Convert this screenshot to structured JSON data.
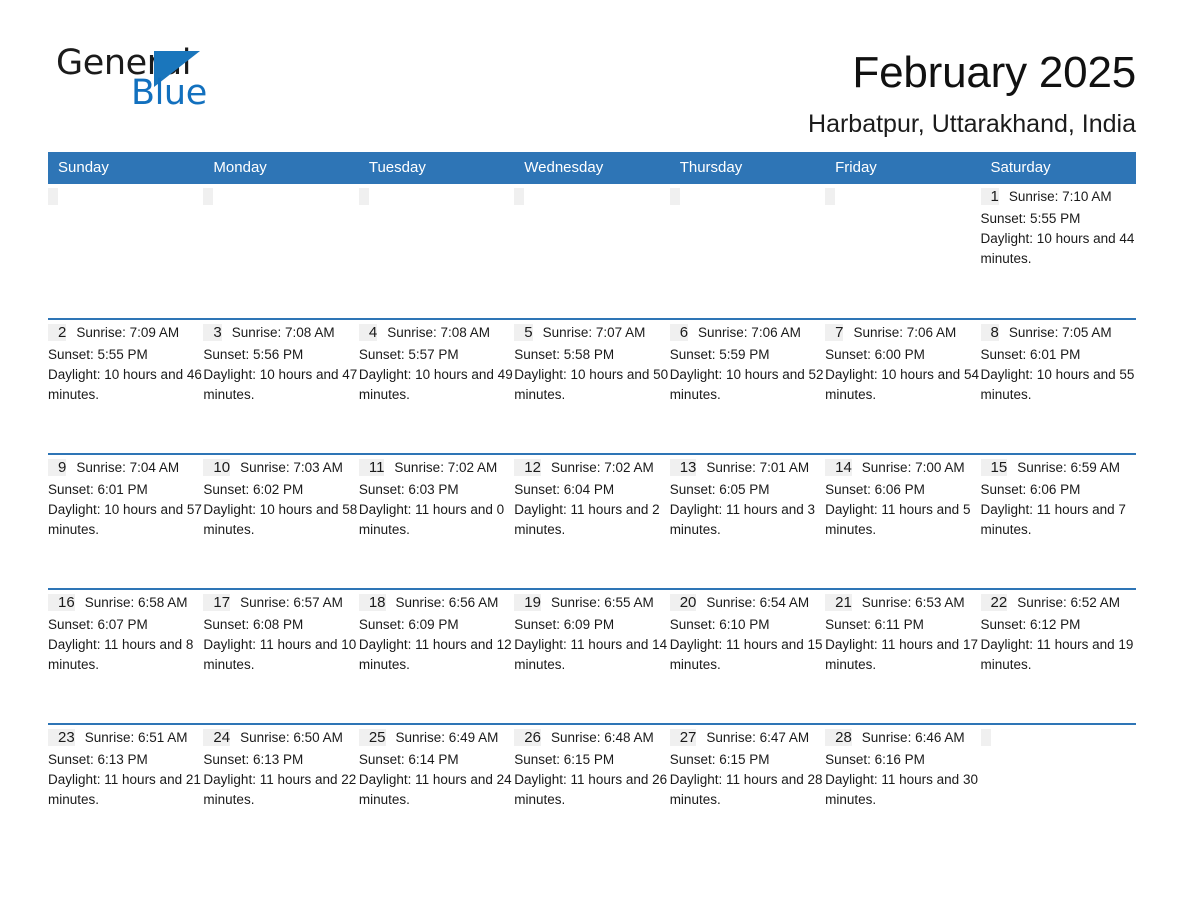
{
  "brand": {
    "name_part1": "General",
    "name_part2": "Blue",
    "triangle_color": "#1a76bc",
    "blue_text_color": "#1270be"
  },
  "header": {
    "month_title": "February 2025",
    "location": "Harbatpur, Uttarakhand, India"
  },
  "theme": {
    "header_row_color": "#2e75b6",
    "day_band_color": "#f0f0f0",
    "row_divider_color": "#2e75b6"
  },
  "weekday_headers": [
    "Sunday",
    "Monday",
    "Tuesday",
    "Wednesday",
    "Thursday",
    "Friday",
    "Saturday"
  ],
  "weeks": [
    [
      {
        "day": "",
        "info": ""
      },
      {
        "day": "",
        "info": ""
      },
      {
        "day": "",
        "info": ""
      },
      {
        "day": "",
        "info": ""
      },
      {
        "day": "",
        "info": ""
      },
      {
        "day": "",
        "info": ""
      },
      {
        "day": "1",
        "info": "Sunrise: 7:10 AM\nSunset: 5:55 PM\nDaylight: 10 hours and 44 minutes."
      }
    ],
    [
      {
        "day": "2",
        "info": "Sunrise: 7:09 AM\nSunset: 5:55 PM\nDaylight: 10 hours and 46 minutes."
      },
      {
        "day": "3",
        "info": "Sunrise: 7:08 AM\nSunset: 5:56 PM\nDaylight: 10 hours and 47 minutes."
      },
      {
        "day": "4",
        "info": "Sunrise: 7:08 AM\nSunset: 5:57 PM\nDaylight: 10 hours and 49 minutes."
      },
      {
        "day": "5",
        "info": "Sunrise: 7:07 AM\nSunset: 5:58 PM\nDaylight: 10 hours and 50 minutes."
      },
      {
        "day": "6",
        "info": "Sunrise: 7:06 AM\nSunset: 5:59 PM\nDaylight: 10 hours and 52 minutes."
      },
      {
        "day": "7",
        "info": "Sunrise: 7:06 AM\nSunset: 6:00 PM\nDaylight: 10 hours and 54 minutes."
      },
      {
        "day": "8",
        "info": "Sunrise: 7:05 AM\nSunset: 6:01 PM\nDaylight: 10 hours and 55 minutes."
      }
    ],
    [
      {
        "day": "9",
        "info": "Sunrise: 7:04 AM\nSunset: 6:01 PM\nDaylight: 10 hours and 57 minutes."
      },
      {
        "day": "10",
        "info": "Sunrise: 7:03 AM\nSunset: 6:02 PM\nDaylight: 10 hours and 58 minutes."
      },
      {
        "day": "11",
        "info": "Sunrise: 7:02 AM\nSunset: 6:03 PM\nDaylight: 11 hours and 0 minutes."
      },
      {
        "day": "12",
        "info": "Sunrise: 7:02 AM\nSunset: 6:04 PM\nDaylight: 11 hours and 2 minutes."
      },
      {
        "day": "13",
        "info": "Sunrise: 7:01 AM\nSunset: 6:05 PM\nDaylight: 11 hours and 3 minutes."
      },
      {
        "day": "14",
        "info": "Sunrise: 7:00 AM\nSunset: 6:06 PM\nDaylight: 11 hours and 5 minutes."
      },
      {
        "day": "15",
        "info": "Sunrise: 6:59 AM\nSunset: 6:06 PM\nDaylight: 11 hours and 7 minutes."
      }
    ],
    [
      {
        "day": "16",
        "info": "Sunrise: 6:58 AM\nSunset: 6:07 PM\nDaylight: 11 hours and 8 minutes."
      },
      {
        "day": "17",
        "info": "Sunrise: 6:57 AM\nSunset: 6:08 PM\nDaylight: 11 hours and 10 minutes."
      },
      {
        "day": "18",
        "info": "Sunrise: 6:56 AM\nSunset: 6:09 PM\nDaylight: 11 hours and 12 minutes."
      },
      {
        "day": "19",
        "info": "Sunrise: 6:55 AM\nSunset: 6:09 PM\nDaylight: 11 hours and 14 minutes."
      },
      {
        "day": "20",
        "info": "Sunrise: 6:54 AM\nSunset: 6:10 PM\nDaylight: 11 hours and 15 minutes."
      },
      {
        "day": "21",
        "info": "Sunrise: 6:53 AM\nSunset: 6:11 PM\nDaylight: 11 hours and 17 minutes."
      },
      {
        "day": "22",
        "info": "Sunrise: 6:52 AM\nSunset: 6:12 PM\nDaylight: 11 hours and 19 minutes."
      }
    ],
    [
      {
        "day": "23",
        "info": "Sunrise: 6:51 AM\nSunset: 6:13 PM\nDaylight: 11 hours and 21 minutes."
      },
      {
        "day": "24",
        "info": "Sunrise: 6:50 AM\nSunset: 6:13 PM\nDaylight: 11 hours and 22 minutes."
      },
      {
        "day": "25",
        "info": "Sunrise: 6:49 AM\nSunset: 6:14 PM\nDaylight: 11 hours and 24 minutes."
      },
      {
        "day": "26",
        "info": "Sunrise: 6:48 AM\nSunset: 6:15 PM\nDaylight: 11 hours and 26 minutes."
      },
      {
        "day": "27",
        "info": "Sunrise: 6:47 AM\nSunset: 6:15 PM\nDaylight: 11 hours and 28 minutes."
      },
      {
        "day": "28",
        "info": "Sunrise: 6:46 AM\nSunset: 6:16 PM\nDaylight: 11 hours and 30 minutes."
      },
      {
        "day": "",
        "info": ""
      }
    ]
  ]
}
